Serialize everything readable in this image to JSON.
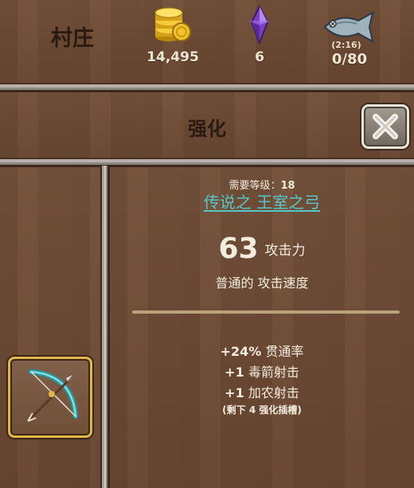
{
  "header": {
    "location": "村庄",
    "gold": "14,495",
    "gems": "6",
    "fish_timer": "(2:16)",
    "fish": "0/80"
  },
  "panel": {
    "title": "强化"
  },
  "item": {
    "required_level_label": "需要等级：",
    "required_level": "18",
    "name": "传说之 王室之弓",
    "attack_value": "63",
    "attack_label": "攻击力",
    "attack_speed": "普通的 攻击速度",
    "bonuses": [
      {
        "value": "+24%",
        "label": "贯通率"
      },
      {
        "value": "+1",
        "label": "毒箭射击"
      },
      {
        "value": "+1",
        "label": "加农射击"
      }
    ],
    "slots_prefix": "(剩下",
    "slots_count": "4",
    "slots_suffix": "强化插槽)"
  },
  "colors": {
    "wood": "#6b4a30",
    "item_name": "#56c7c8",
    "slot_border": "#e2b54a"
  },
  "icons": [
    "gold-coins-icon",
    "purple-gem-icon",
    "fish-icon",
    "close-icon",
    "bow-icon"
  ]
}
